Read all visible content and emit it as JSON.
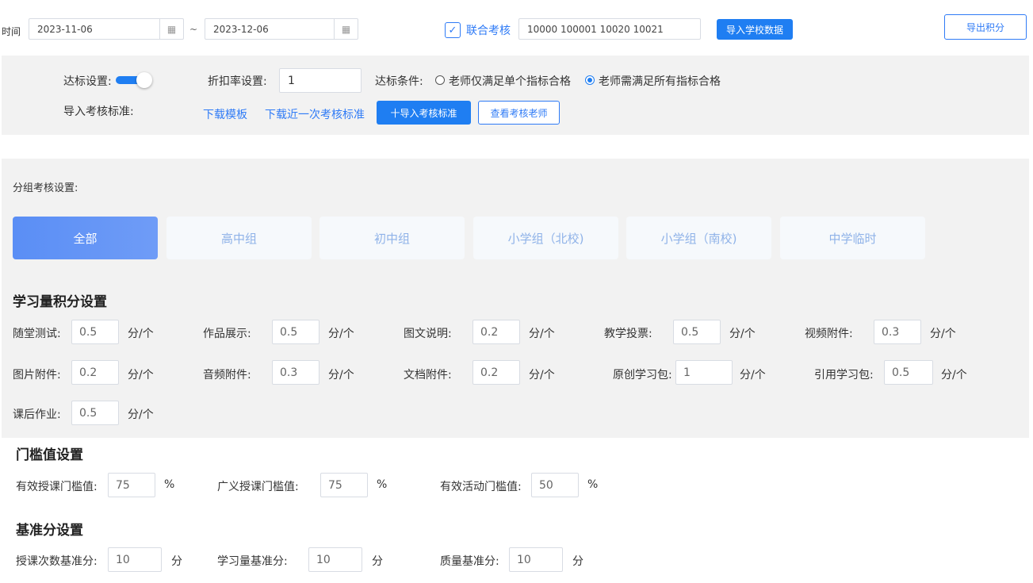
{
  "topbar": {
    "time_label": "时间",
    "start_date": "2023-11-06",
    "separator": "~",
    "end_date": "2023-12-06",
    "joint_check_label": "联合考核",
    "joint_ids": "10000 100001 10020 10021",
    "import_school_btn": "导入学校数据",
    "export_points_btn": "导出积分"
  },
  "standard": {
    "reach_label": "达标设置:",
    "reach_toggle_on": true,
    "discount_label": "折扣率设置:",
    "discount_value": "1",
    "condition_label": "达标条件:",
    "condition_options": [
      {
        "label": "老师仅满足单个指标合格",
        "selected": false
      },
      {
        "label": "老师需满足所有指标合格",
        "selected": true
      }
    ],
    "import_std_label": "导入考核标准:",
    "download_template": "下载模板",
    "download_recent": "下载近一次考核标准",
    "import_std_btn": "十导入考核标准",
    "view_teachers_btn": "查看考核老师"
  },
  "group": {
    "title": "分组考核设置:",
    "tabs": [
      {
        "label": "全部",
        "active": true
      },
      {
        "label": "高中组",
        "active": false
      },
      {
        "label": "初中组",
        "active": false
      },
      {
        "label": "小学组（北校)",
        "active": false
      },
      {
        "label": "小学组（南校)",
        "active": false
      },
      {
        "label": "中学临时",
        "active": false
      }
    ]
  },
  "study": {
    "title": "学习量积分设置",
    "unit": "分/个",
    "items": [
      {
        "label": "随堂测试:",
        "value": "0.5"
      },
      {
        "label": "作品展示:",
        "value": "0.5"
      },
      {
        "label": "图文说明:",
        "value": "0.2"
      },
      {
        "label": "教学投票:",
        "value": "0.5"
      },
      {
        "label": "视频附件:",
        "value": "0.3"
      },
      {
        "label": "图片附件:",
        "value": "0.2"
      },
      {
        "label": "音频附件:",
        "value": "0.3"
      },
      {
        "label": "文档附件:",
        "value": "0.2"
      },
      {
        "label": "原创学习包:",
        "value": "1"
      },
      {
        "label": "引用学习包:",
        "value": "0.5"
      },
      {
        "label": "课后作业:",
        "value": "0.5"
      }
    ]
  },
  "threshold": {
    "title": "门槛值设置",
    "unit": "%",
    "items": [
      {
        "label": "有效授课门槛值:",
        "value": "75"
      },
      {
        "label": "广义授课门槛值:",
        "value": "75"
      },
      {
        "label": "有效活动门槛值:",
        "value": "50"
      }
    ]
  },
  "base": {
    "title": "基准分设置",
    "unit": "分",
    "items": [
      {
        "label": "授课次数基准分:",
        "value": "10"
      },
      {
        "label": "学习量基准分:",
        "value": "10"
      },
      {
        "label": "质量基准分:",
        "value": "10"
      }
    ]
  },
  "colors": {
    "primary": "#1f7ef2",
    "panel_bg": "#f2f2f2",
    "tab_inactive_text": "#8fb2e8"
  }
}
